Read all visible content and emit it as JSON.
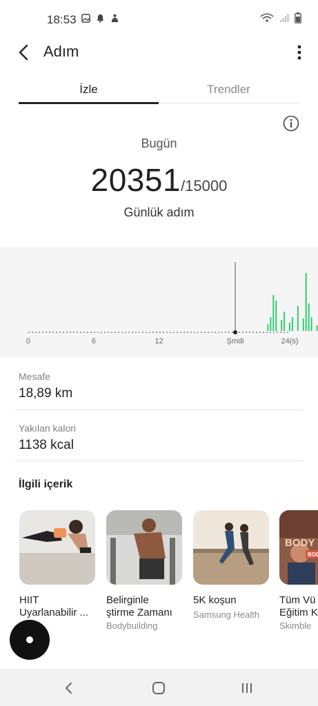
{
  "status_bar": {
    "time": "18:53",
    "left_icons": [
      "image-icon",
      "bell-icon",
      "person-icon"
    ],
    "right_icons": [
      "wifi-icon",
      "signal-icon",
      "battery-icon"
    ]
  },
  "app_bar": {
    "title": "Adım"
  },
  "tabs": [
    {
      "label": "İzle",
      "active": true
    },
    {
      "label": "Trendler",
      "active": false
    }
  ],
  "summary": {
    "period_label": "Bugün",
    "steps": "20351",
    "goal": "/15000",
    "unit_label": "Günlük adım"
  },
  "chart_data": {
    "type": "bar",
    "x_ticks": [
      "0",
      "6",
      "12",
      "Şmdi",
      "24(s)"
    ],
    "xlim": [
      0,
      24
    ],
    "now_hour": 19,
    "hours_per_bar": 0.25,
    "accent_color": "#2ecc71",
    "values": [
      0,
      0,
      0,
      0,
      0,
      0,
      0,
      0,
      0,
      0,
      0,
      0,
      0,
      0,
      0,
      0,
      0,
      0,
      0,
      0,
      0,
      0,
      0,
      0,
      0,
      0,
      0,
      0,
      0,
      0,
      0,
      0,
      0,
      0,
      0,
      0,
      0,
      0,
      0,
      0,
      0,
      0,
      0,
      0,
      0,
      0,
      0,
      0,
      0,
      0,
      0,
      0,
      0,
      0,
      0,
      0,
      0,
      0,
      0,
      0,
      0,
      0,
      0,
      0,
      0,
      0,
      0,
      0,
      0,
      0,
      0,
      0,
      0,
      0,
      0,
      0,
      0,
      0,
      0,
      0,
      0,
      0,
      0,
      0,
      0,
      0,
      0,
      0,
      5,
      10,
      26,
      22,
      0,
      8,
      14,
      0,
      6,
      10,
      0,
      18,
      0,
      9,
      42,
      20,
      10,
      0,
      4,
      6,
      0,
      0,
      20,
      10,
      0,
      0,
      28,
      12,
      0,
      8,
      3,
      0,
      0,
      0,
      0,
      0,
      0,
      0,
      0,
      0,
      0,
      0,
      0,
      0,
      0,
      0,
      0,
      0
    ],
    "y_max": 50
  },
  "stats": [
    {
      "label": "Mesafe",
      "value": "18,89 km"
    },
    {
      "label": "Yakılan kalori",
      "value": "1138 kcal"
    }
  ],
  "related": {
    "title": "İlgili içerik",
    "items": [
      {
        "title": "HIIT",
        "title2": "Uyarlanabilir ...",
        "source": ""
      },
      {
        "title": "Belirginle",
        "title2": "ştirme Zamanı",
        "source": "Bodybuilding"
      },
      {
        "title": "5K koşun",
        "title2": "",
        "source": "Samsung Health"
      },
      {
        "title": "Tüm Vü",
        "title2": "Eğitim K",
        "source": "Skimble"
      }
    ],
    "card4_overlay": "BODY",
    "card4_overlay_small": "BODY"
  },
  "nav_icons": [
    "back-nav-icon",
    "home-nav-icon",
    "recents-nav-icon"
  ]
}
